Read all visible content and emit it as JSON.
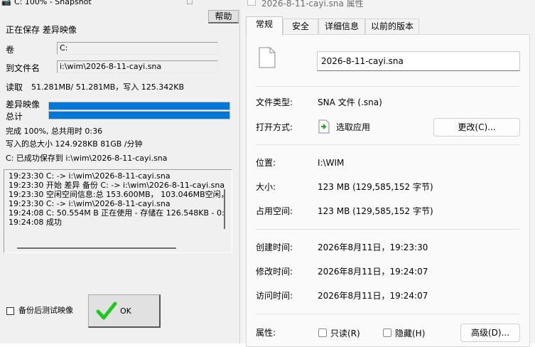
{
  "snapshot": {
    "title": "C: 100% - Snapshot",
    "help_label": "帮助",
    "status": "正在保存 差异映像",
    "volume_label": "卷",
    "volume_value": "C:",
    "target_label": "到文件名",
    "target_value": "i:\\wim\\2026-8-11-cayi.sna",
    "read_label": "读取",
    "read_value": "51.281MB/  51.281MB，写入   125.342KB",
    "diff_label": "差异映像",
    "total_label": "总计",
    "diff_progress": 1.0,
    "total_progress": 1.0,
    "complete_text": "完成 100%, 总共用时  0:36",
    "written_text": "写入的总大小   124.928KB   81GB /分钟",
    "saved_text": "C: 已成功保存到 i:\\wim\\2026-8-11-cayi.sna",
    "log": [
      "19:23:30    C: -> i:\\wim\\2026-8-11-cayi.sna",
      "19:23:30 开始 差异 备份 C: -> i:\\wim\\2026-8-11-cayi.sna",
      "19:23:30 空闲空间信息:总 153.600MB，   103.046MB空闲，",
      "19:23:30 C: -> i:\\wim\\2026-8-11-cayi.sna",
      "19:24:08 C:   50.554M B 正在使用 - 存储在   126.548KB - 0:",
      "19:24:08 成功"
    ],
    "verify_label": "备份后测试映像",
    "verify_checked": false,
    "ok_label": "OK"
  },
  "properties": {
    "title": "2026-8-11-cayi.sna 属性",
    "tabs": [
      "常规",
      "安全",
      "详细信息",
      "以前的版本"
    ],
    "active_tab": 0,
    "file_name": "2026-8-11-cayi.sna",
    "type_label": "文件类型:",
    "type_value": "SNA 文件 (.sna)",
    "open_label": "打开方式:",
    "open_value": "选取应用",
    "change_button": "更改(C)...",
    "location_label": "位置:",
    "location_value": "I:\\WIM",
    "size_label": "大小:",
    "size_value": "123 MB (129,585,152 字节)",
    "disk_label": "占用空间:",
    "disk_value": "123 MB (129,585,152 字节)",
    "created_label": "创建时间:",
    "created_value": "2026年8月11日，19:23:30",
    "modified_label": "修改时间:",
    "modified_value": "2026年8月11日，19:24:07",
    "accessed_label": "访问时间:",
    "accessed_value": "2026年8月11日，19:24:07",
    "attr_label": "属性:",
    "readonly_label": "只读(R)",
    "hidden_label": "隐藏(H)",
    "advanced_button": "高级(D)..."
  },
  "colors": {
    "progress": "#0078d7",
    "ok_check": "#1ec81e"
  }
}
